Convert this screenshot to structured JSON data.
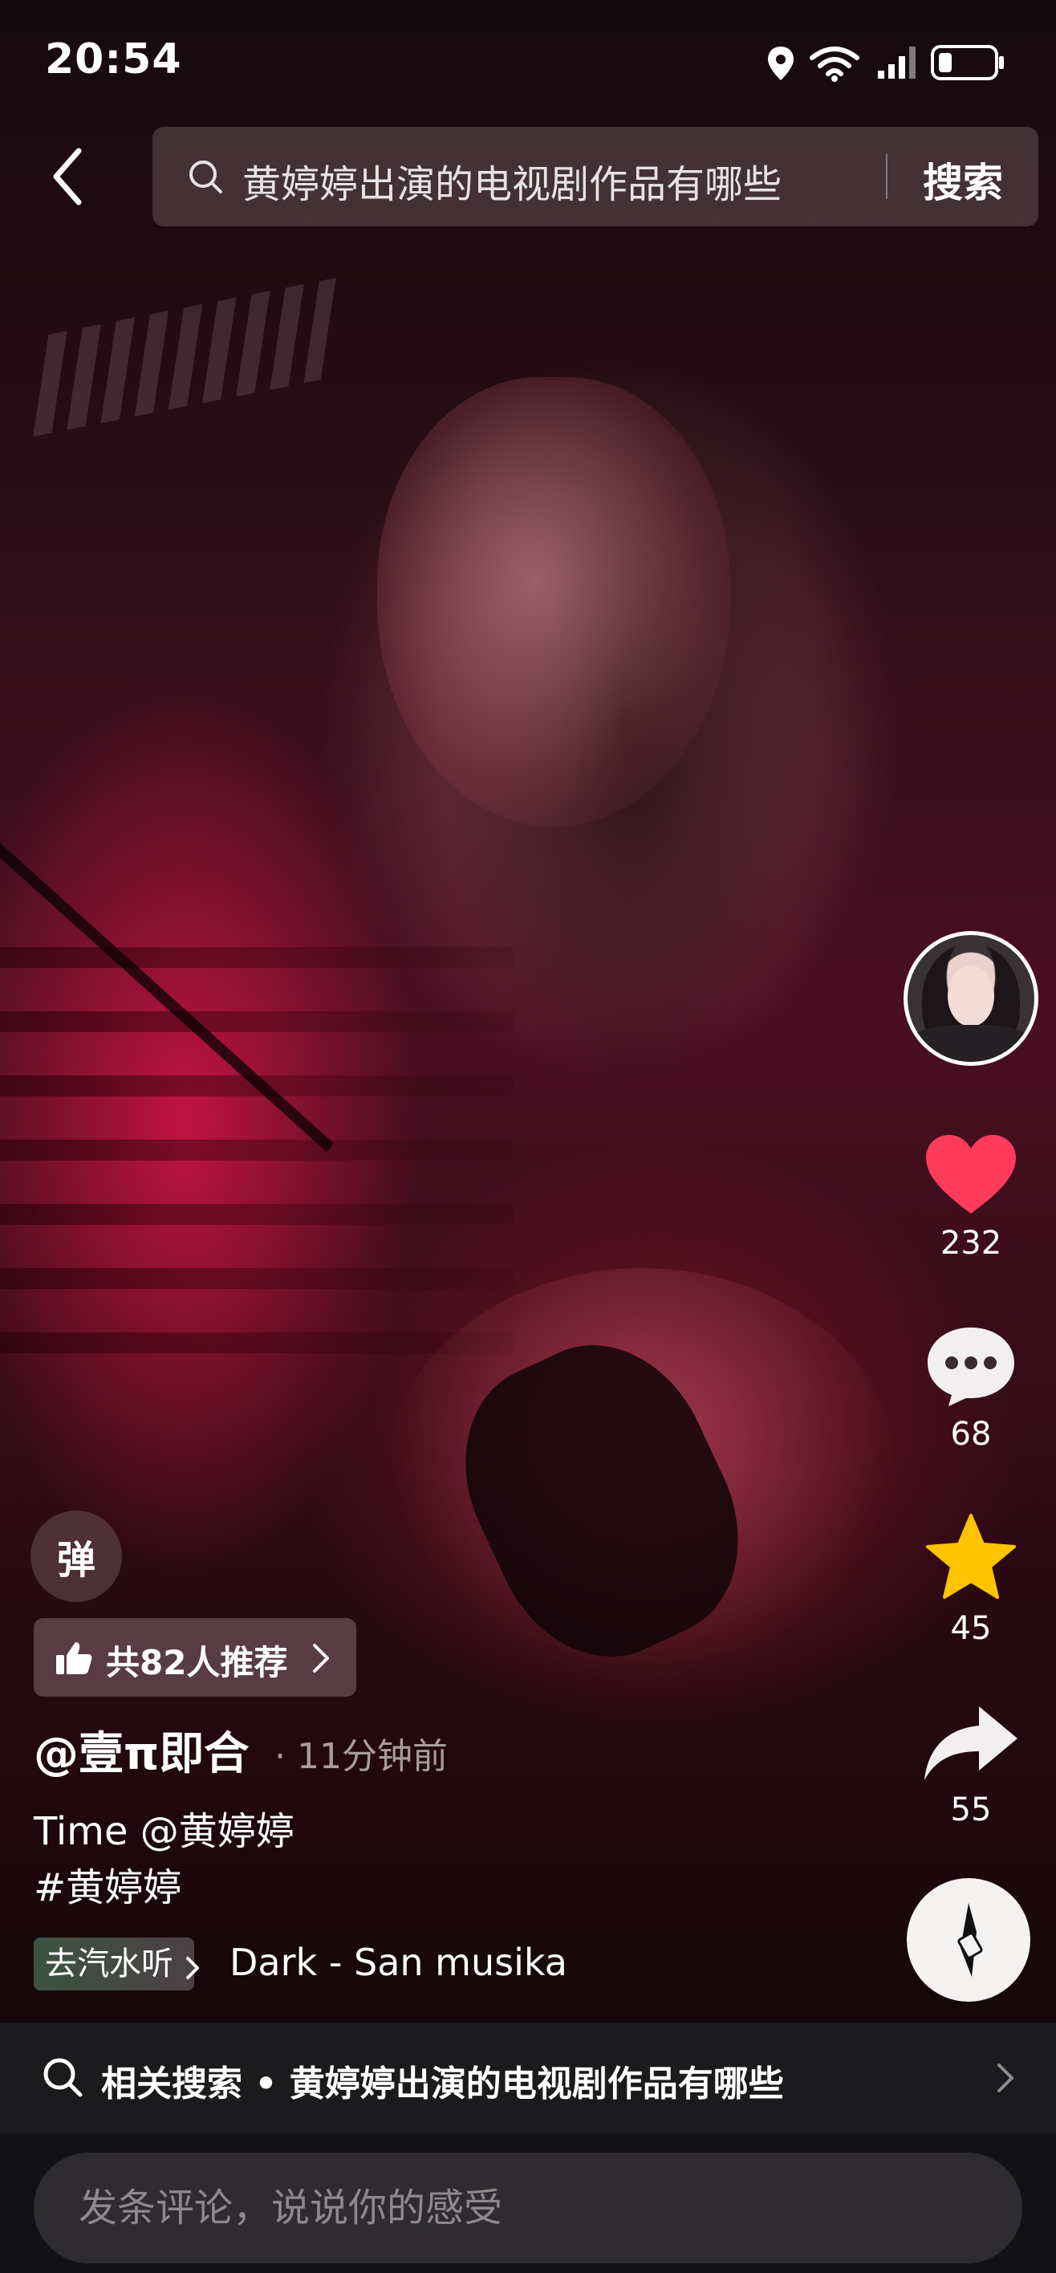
{
  "status_bar": {
    "time": "20:54",
    "icons": [
      "location-icon",
      "wifi-icon",
      "signal-icon",
      "battery-icon"
    ]
  },
  "header": {
    "search_query": "黄婷婷出演的电视剧作品有哪些",
    "search_button": "搜索"
  },
  "actions": {
    "likes": "232",
    "comments": "68",
    "favorites": "45",
    "shares": "55",
    "like_color": "#ff3b5c",
    "favorite_color": "#ffc300"
  },
  "post": {
    "danmu_label": "弹",
    "recommend": "共82人推荐",
    "author": "@壹π即合",
    "time": "· 11分钟前",
    "caption_line1": "Time @黄婷婷",
    "caption_line2": "#黄婷婷",
    "music_tag": "去汽水听",
    "music_title": "Dark - San musika"
  },
  "related_search": {
    "text": "相关搜索 • 黄婷婷出演的电视剧作品有哪些"
  },
  "comment": {
    "placeholder": "发条评论，说说你的感受"
  }
}
